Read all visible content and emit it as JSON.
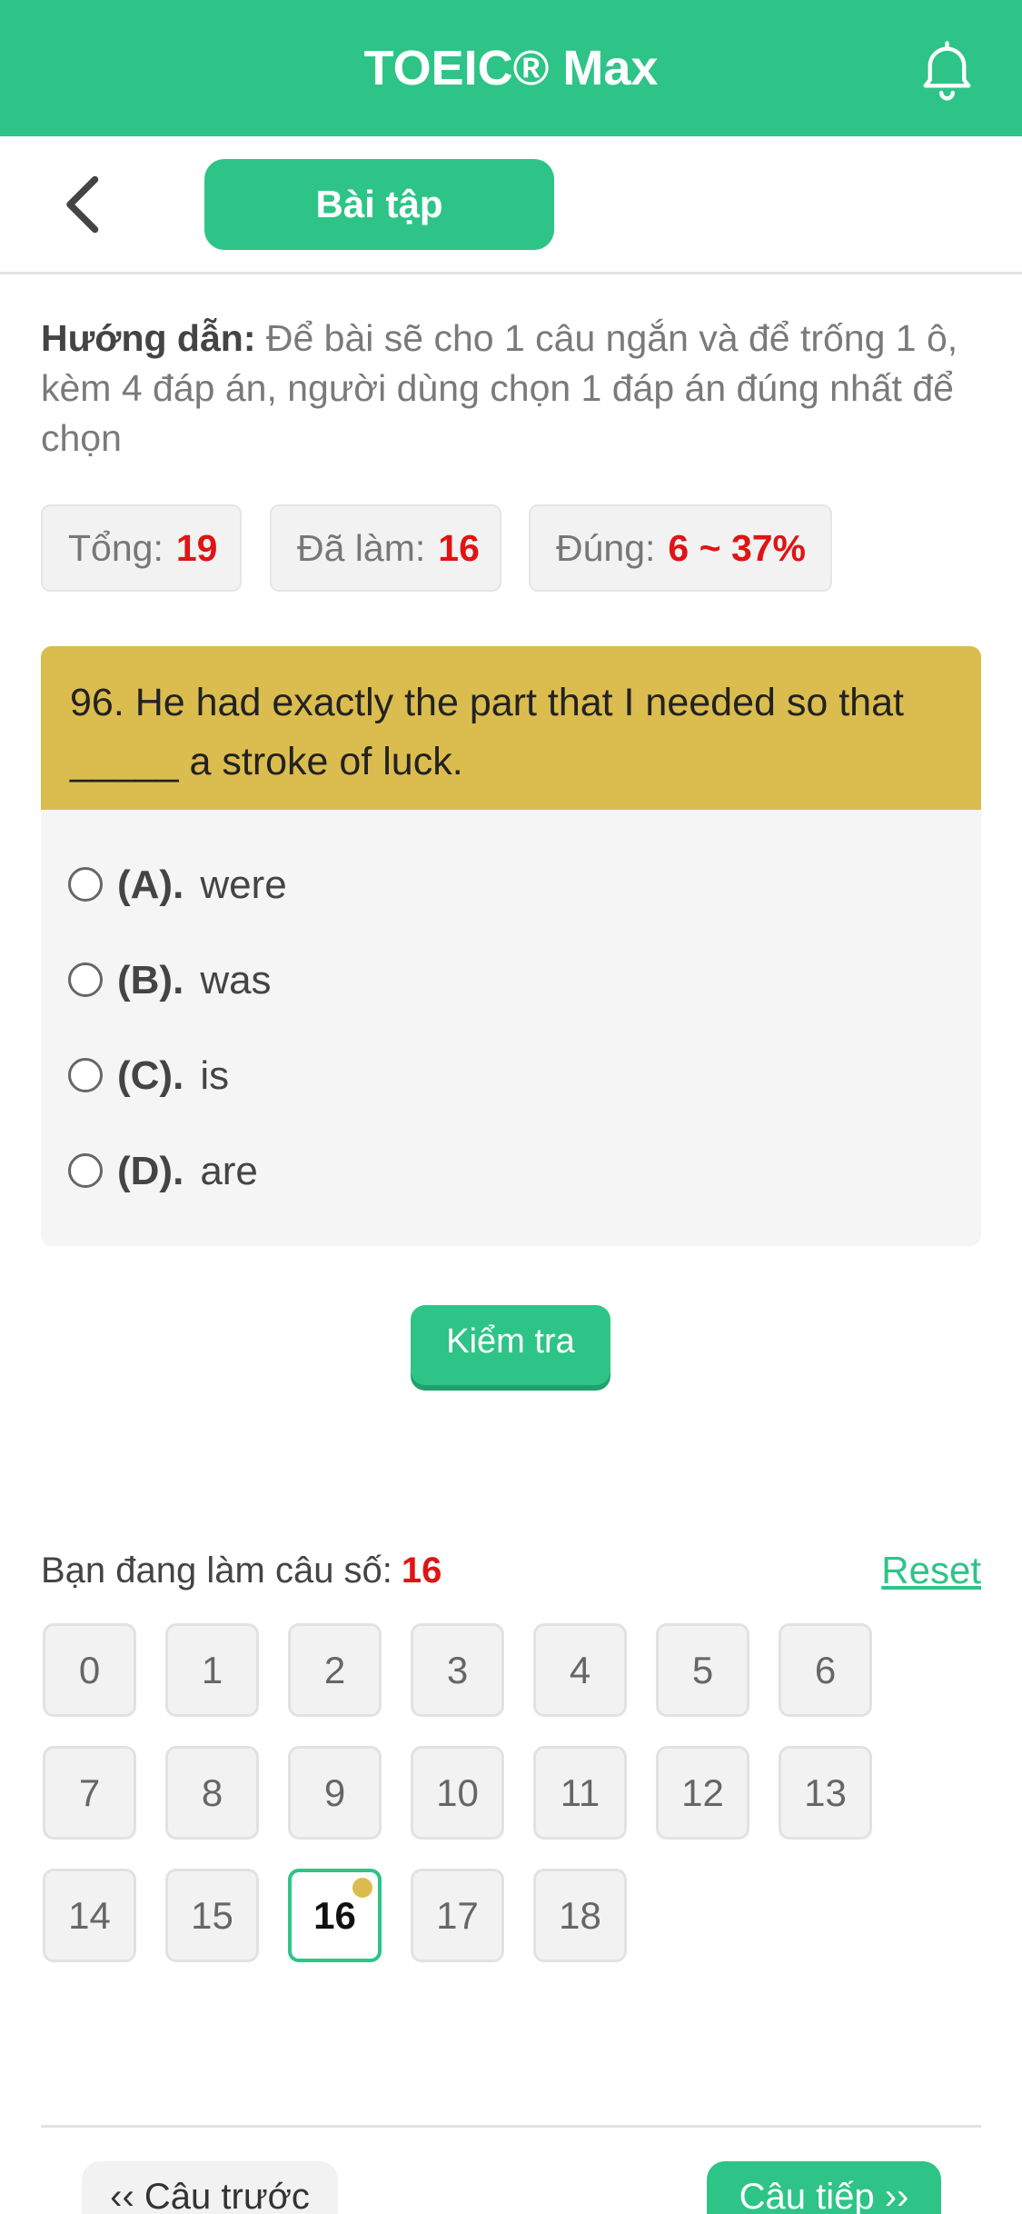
{
  "header": {
    "title": "TOEIC® Max",
    "bell_icon": "bell-icon"
  },
  "subnav": {
    "back_icon": "chevron-left-icon",
    "tab_label": "Bài tập"
  },
  "instructions": {
    "label": "Hướng dẫn:",
    "text": " Để bài sẽ cho 1 câu ngắn và để trống 1 ô, kèm 4 đáp án, người dùng chọn 1 đáp án đúng nhất để chọn"
  },
  "stats": {
    "total_label": "Tổng:",
    "total_value": "19",
    "done_label": "Đã làm:",
    "done_value": "16",
    "correct_label": "Đúng:",
    "correct_value": "6 ~ 37%"
  },
  "question": {
    "text": "96. He had exactly the part that I needed so that _____ a stroke of luck.",
    "options": [
      {
        "label": "(A).",
        "text": "were"
      },
      {
        "label": "(B).",
        "text": "was"
      },
      {
        "label": "(C).",
        "text": "is"
      },
      {
        "label": "(D).",
        "text": "are"
      }
    ]
  },
  "check_button": "Kiểm tra",
  "progress": {
    "label": "Bạn đang làm câu số:",
    "value": "16",
    "reset_label": "Reset"
  },
  "question_numbers": [
    "0",
    "1",
    "2",
    "3",
    "4",
    "5",
    "6",
    "7",
    "8",
    "9",
    "10",
    "11",
    "12",
    "13",
    "14",
    "15",
    "16",
    "17",
    "18"
  ],
  "current_question": "16",
  "footer": {
    "prev_label": "‹‹ Câu trước",
    "next_label": "Câu tiếp ››"
  },
  "colors": {
    "primary": "#2ec487",
    "question_bg": "#dbbc4e",
    "highlight": "#e01414"
  }
}
